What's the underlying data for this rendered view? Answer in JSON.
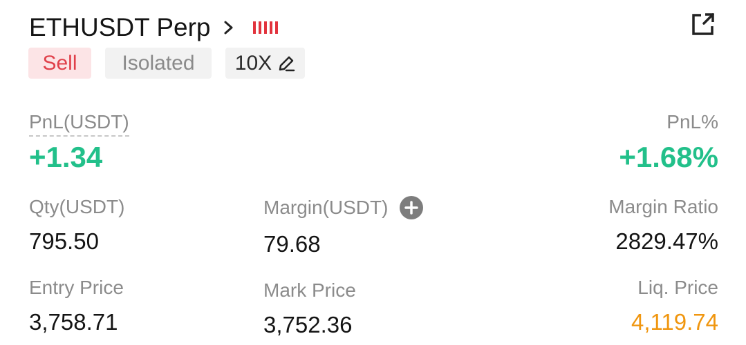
{
  "header": {
    "symbol": "ETHUSDT Perp",
    "icons": {
      "chevron": "chevron-right-icon",
      "bars": "volatility-bars-icon",
      "share": "share-external-icon"
    },
    "accent_color": "#e2333d"
  },
  "tags": {
    "side": "Sell",
    "margin_mode": "Isolated",
    "leverage": "10X",
    "edit_icon": "pencil-icon"
  },
  "pnl": {
    "label": "PnL(USDT)",
    "value": "+1.34",
    "color": "#22c08a"
  },
  "pnl_percent": {
    "label": "PnL%",
    "value": "+1.68%"
  },
  "qty": {
    "label": "Qty(USDT)",
    "value": "795.50"
  },
  "margin": {
    "label": "Margin(USDT)",
    "value": "79.68",
    "add_icon": "plus-circle-icon"
  },
  "margin_ratio": {
    "label": "Margin Ratio",
    "value": "2829.47%"
  },
  "entry_price": {
    "label": "Entry Price",
    "value": "3,758.71"
  },
  "mark_price": {
    "label": "Mark Price",
    "value": "3,752.36"
  },
  "liq_price": {
    "label": "Liq. Price",
    "value": "4,119.74",
    "color": "#f0960f"
  }
}
